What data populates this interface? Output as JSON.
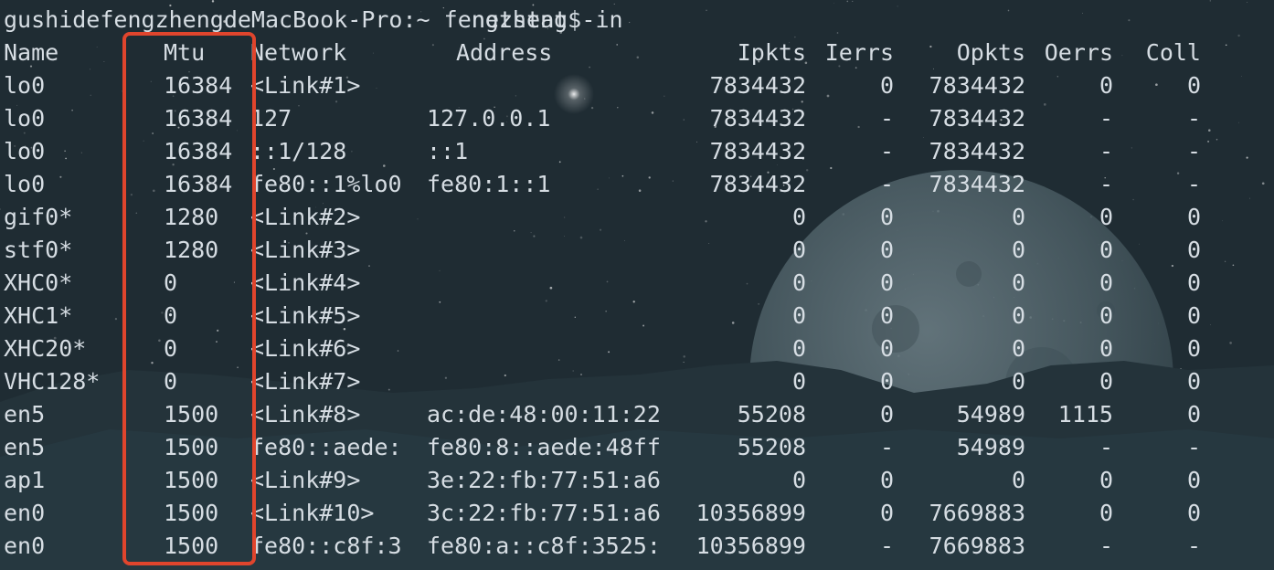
{
  "prompt": {
    "user_host": "gushidefengzhengdeMacBook-Pro:~ fengzheng$",
    "command": "netstat -in"
  },
  "table": {
    "headers": [
      "Name",
      "Mtu",
      "Network",
      "Address",
      "Ipkts",
      "Ierrs",
      "Opkts",
      "Oerrs",
      "Coll"
    ],
    "rows": [
      [
        "lo0",
        "16384",
        "<Link#1>",
        "",
        "7834432",
        "0",
        "7834432",
        "0",
        "0"
      ],
      [
        "lo0",
        "16384",
        "127",
        "127.0.0.1",
        "7834432",
        "-",
        "7834432",
        "-",
        "-"
      ],
      [
        "lo0",
        "16384",
        "::1/128",
        "::1",
        "7834432",
        "-",
        "7834432",
        "-",
        "-"
      ],
      [
        "lo0",
        "16384",
        "fe80::1%lo0",
        "fe80:1::1",
        "7834432",
        "-",
        "7834432",
        "-",
        "-"
      ],
      [
        "gif0*",
        "1280",
        "<Link#2>",
        "",
        "0",
        "0",
        "0",
        "0",
        "0"
      ],
      [
        "stf0*",
        "1280",
        "<Link#3>",
        "",
        "0",
        "0",
        "0",
        "0",
        "0"
      ],
      [
        "XHC0*",
        "0",
        "<Link#4>",
        "",
        "0",
        "0",
        "0",
        "0",
        "0"
      ],
      [
        "XHC1*",
        "0",
        "<Link#5>",
        "",
        "0",
        "0",
        "0",
        "0",
        "0"
      ],
      [
        "XHC20*",
        "0",
        "<Link#6>",
        "",
        "0",
        "0",
        "0",
        "0",
        "0"
      ],
      [
        "VHC128*",
        "0",
        "<Link#7>",
        "",
        "0",
        "0",
        "0",
        "0",
        "0"
      ],
      [
        "en5",
        "1500",
        "<Link#8>",
        "ac:de:48:00:11:22",
        "55208",
        "0",
        "54989",
        "1115",
        "0"
      ],
      [
        "en5",
        "1500",
        "fe80::aede:",
        "fe80:8::aede:48ff",
        "55208",
        "-",
        "54989",
        "-",
        "-"
      ],
      [
        "ap1",
        "1500",
        "<Link#9>",
        "3e:22:fb:77:51:a6",
        "0",
        "0",
        "0",
        "0",
        "0"
      ],
      [
        "en0",
        "1500",
        "<Link#10>",
        "3c:22:fb:77:51:a6",
        "10356899",
        "0",
        "7669883",
        "0",
        "0"
      ],
      [
        "en0",
        "1500",
        "fe80::c8f:3",
        "fe80:a::c8f:3525:",
        "10356899",
        "-",
        "7669883",
        "-",
        "-"
      ]
    ]
  },
  "highlight": {
    "column": "Mtu",
    "color": "#e0452d"
  },
  "colors": {
    "text": "#d6dde3",
    "background": "#1f2c33"
  }
}
